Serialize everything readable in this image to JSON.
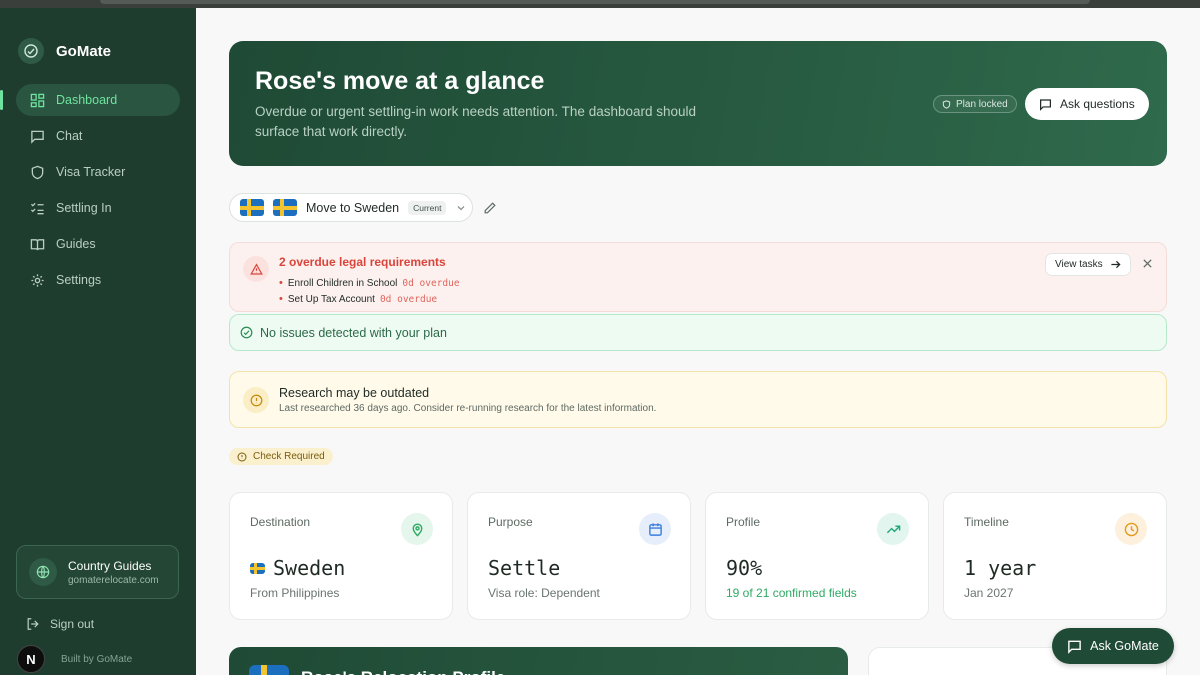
{
  "app": {
    "name": "GoMate"
  },
  "sidebar": {
    "items": [
      {
        "label": "Dashboard",
        "icon": "dashboard-icon",
        "active": true
      },
      {
        "label": "Chat",
        "icon": "chat-icon"
      },
      {
        "label": "Visa Tracker",
        "icon": "shield-icon"
      },
      {
        "label": "Settling In",
        "icon": "checklist-icon"
      },
      {
        "label": "Guides",
        "icon": "book-icon"
      },
      {
        "label": "Settings",
        "icon": "gear-icon"
      }
    ],
    "country_guides": {
      "title": "Country Guides",
      "url": "gomaterelocate.com"
    },
    "sign_out": "Sign out",
    "built_by": "Built by GoMate",
    "n_badge": "N"
  },
  "hero": {
    "title": "Rose's move at a glance",
    "subtitle": "Overdue or urgent settling-in work needs attention. The dashboard should surface that work directly.",
    "plan_locked": "Plan locked",
    "ask_questions": "Ask questions"
  },
  "destination_select": {
    "label": "Move to Sweden",
    "badge": "Current"
  },
  "alert_overdue": {
    "title": "2 overdue legal requirements",
    "items": [
      {
        "name": "Enroll Children in School",
        "status": "0d overdue"
      },
      {
        "name": "Set Up Tax Account",
        "status": "0d overdue"
      }
    ],
    "view_tasks": "View tasks"
  },
  "alert_ok": {
    "text": "No issues detected with your plan"
  },
  "alert_research": {
    "title": "Research may be outdated",
    "subtitle": "Last researched 36 days ago. Consider re-running research for the latest information."
  },
  "check_required": "Check Required",
  "stats": [
    {
      "label": "Destination",
      "value": "Sweden",
      "sub": "From Philippines",
      "icon": "map-pin-icon",
      "color": "#2faa64"
    },
    {
      "label": "Purpose",
      "value": "Settle",
      "sub": "Visa role: Dependent",
      "icon": "calendar-icon",
      "color": "#3b7ddd"
    },
    {
      "label": "Profile",
      "value": "90%",
      "sub": "19 of 21 confirmed fields",
      "icon": "trending-up-icon",
      "color": "#1fa67a"
    },
    {
      "label": "Timeline",
      "value": "1 year",
      "sub": "Jan 2027",
      "icon": "clock-icon",
      "color": "#e39a1c"
    }
  ],
  "profile_banner": {
    "title": "Rose's Relocation Profile"
  },
  "ask_gomate": "Ask GoMate"
}
